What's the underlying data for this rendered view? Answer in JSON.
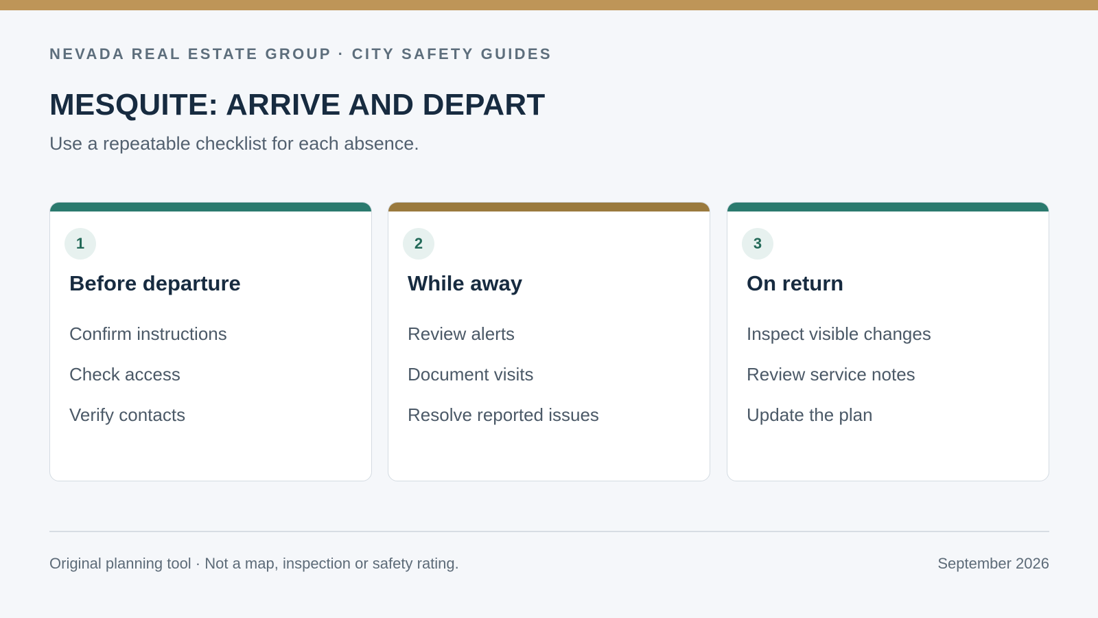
{
  "header": {
    "eyebrow": "NEVADA REAL ESTATE GROUP · CITY SAFETY GUIDES",
    "title": "MESQUITE: ARRIVE AND DEPART",
    "subtitle": "Use a repeatable checklist for each absence."
  },
  "colors": {
    "top_band": "#be9558",
    "accent_teal": "#2b7a6e",
    "accent_gold": "#9a7a3e"
  },
  "cards": [
    {
      "number": "1",
      "title": "Before departure",
      "accent": "#2b7a6e",
      "items": [
        "Confirm instructions",
        "Check access",
        "Verify contacts"
      ]
    },
    {
      "number": "2",
      "title": "While away",
      "accent": "#9a7a3e",
      "items": [
        "Review alerts",
        "Document visits",
        "Resolve reported issues"
      ]
    },
    {
      "number": "3",
      "title": "On return",
      "accent": "#2b7a6e",
      "items": [
        "Inspect visible changes",
        "Review service notes",
        "Update the plan"
      ]
    }
  ],
  "footer": {
    "note": "Original planning tool · Not a map, inspection or safety rating.",
    "date": "September 2026"
  }
}
